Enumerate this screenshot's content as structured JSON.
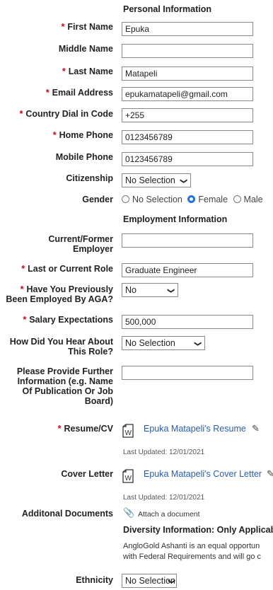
{
  "sections": {
    "personal": "Personal Information",
    "employment": "Employment Information",
    "diversity": "Diversity Information: Only Applicabl"
  },
  "fields": {
    "first_name": {
      "label": "First Name",
      "value": "Epuka"
    },
    "middle_name": {
      "label": "Middle Name",
      "value": ""
    },
    "last_name": {
      "label": "Last Name",
      "value": "Matapeli"
    },
    "email": {
      "label": "Email Address",
      "value": "epukamatapeli@gmail.com"
    },
    "dial_code": {
      "label": "Country Dial in Code",
      "value": "+255"
    },
    "home_phone": {
      "label": "Home Phone",
      "value": "0123456789"
    },
    "mobile_phone": {
      "label": "Mobile Phone",
      "value": "0123456789"
    },
    "citizenship": {
      "label": "Citizenship",
      "value": "No Selection"
    },
    "gender": {
      "label": "Gender",
      "options": [
        "No Selection",
        "Female",
        "Male"
      ],
      "selected": "Female"
    },
    "employer_l1": "Current/Former",
    "employer_l2": "Employer",
    "employer_value": "",
    "role": {
      "label": "Last or Current Role",
      "value": "Graduate Engineer"
    },
    "prev_l1": "Have You Previously",
    "prev_l2": "Been Employed By AGA?",
    "prev_value": "No",
    "salary": {
      "label": "Salary Expectations",
      "value": "500,000"
    },
    "hear_l1": "How Did You Hear About",
    "hear_l2": "This Role?",
    "hear_value": "No Selection",
    "further_l1": "Please Provide Further",
    "further_l2": "Information (e.g. Name",
    "further_l3": "Of Publication Or Job",
    "further_l4": "Board)",
    "further_value": "",
    "resume": {
      "label": "Resume/CV",
      "link": "Epuka Matapeli's Resume",
      "updated": "Last Updated: 12/01/2021"
    },
    "cover": {
      "label": "Cover Letter",
      "link": "Epuka Matapeli's Cover Letter",
      "updated": "Last Updated: 12/01/2021"
    },
    "additional": {
      "label": "Additonal Documents",
      "action": "Attach a document"
    },
    "ethnicity": {
      "label": "Ethnicity",
      "value": "No Selection"
    }
  },
  "diversity_text": {
    "line1": "AngloGold Ashanti is an equal opportun",
    "line2": "with Federal Requirements and will go c"
  },
  "colors": {
    "required": "#d0021b",
    "link": "#2a5db0",
    "radio_on": "#1a73e8"
  }
}
